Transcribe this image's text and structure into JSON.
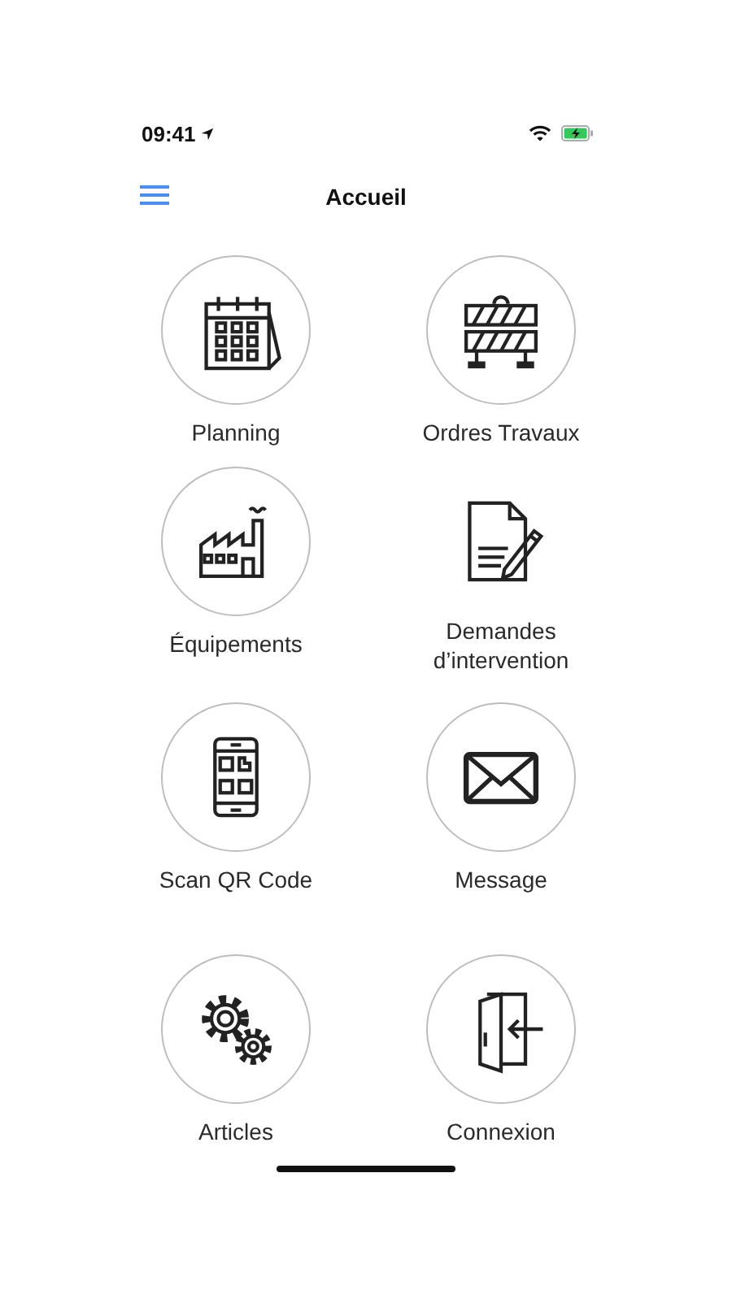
{
  "status_bar": {
    "time": "09:41"
  },
  "nav": {
    "title": "Accueil"
  },
  "tiles": [
    {
      "label": "Planning",
      "kind": "calendar",
      "framed": true
    },
    {
      "label": "Ordres Travaux",
      "kind": "barrier",
      "framed": true
    },
    {
      "label": "Équipements",
      "kind": "factory",
      "framed": true
    },
    {
      "label": "Demandes d’intervention",
      "kind": "document",
      "framed": false
    },
    {
      "label": "Scan QR Code",
      "kind": "qr",
      "framed": true
    },
    {
      "label": "Message",
      "kind": "envelope",
      "framed": true
    },
    {
      "label": "Articles",
      "kind": "gears",
      "framed": true
    },
    {
      "label": "Connexion",
      "kind": "door",
      "framed": true
    }
  ]
}
